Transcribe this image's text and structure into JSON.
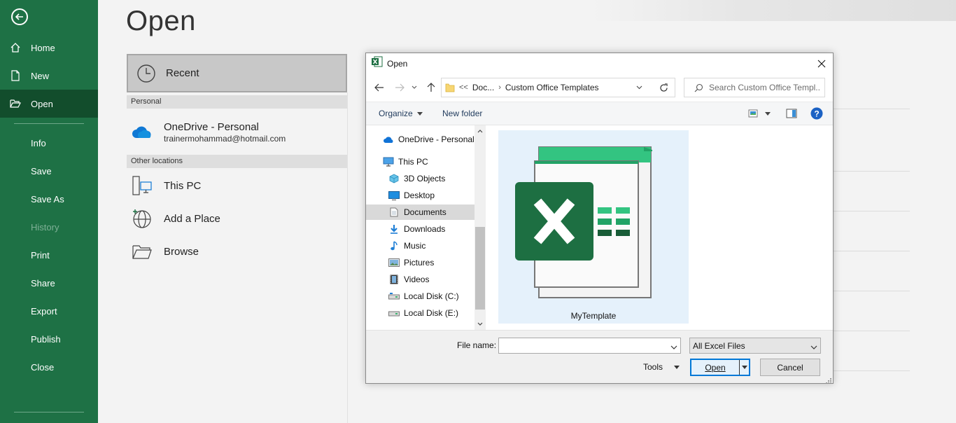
{
  "backstage": {
    "nav": {
      "home": "Home",
      "new": "New",
      "open": "Open",
      "info": "Info",
      "save": "Save",
      "save_as": "Save As",
      "history": "History",
      "print": "Print",
      "share": "Share",
      "export": "Export",
      "publish": "Publish",
      "close": "Close"
    },
    "title": "Open",
    "recent": "Recent",
    "personal_header": "Personal",
    "onedrive": {
      "label": "OneDrive - Personal",
      "email": "trainermohammad@hotmail.com"
    },
    "other_header": "Other locations",
    "this_pc": "This PC",
    "add_place": "Add a Place",
    "browse": "Browse"
  },
  "dialog": {
    "title": "Open",
    "address": {
      "prefix": "<<",
      "crumb1": "Doc...",
      "crumb2": "Custom Office Templates"
    },
    "search_placeholder": "Search Custom Office Templ...",
    "organize": "Organize",
    "new_folder": "New folder",
    "tree": [
      {
        "label": "OneDrive - Personal",
        "icon": "cloud-icon"
      },
      {
        "label": "This PC",
        "icon": "computer-icon"
      },
      {
        "label": "3D Objects",
        "icon": "cube-icon"
      },
      {
        "label": "Desktop",
        "icon": "desktop-icon"
      },
      {
        "label": "Documents",
        "icon": "document-icon"
      },
      {
        "label": "Downloads",
        "icon": "download-arrow-icon"
      },
      {
        "label": "Music",
        "icon": "music-note-icon"
      },
      {
        "label": "Pictures",
        "icon": "pictures-icon"
      },
      {
        "label": "Videos",
        "icon": "film-icon"
      },
      {
        "label": "Local Disk (C:)",
        "icon": "drive-icon"
      },
      {
        "label": "Local Disk (E:)",
        "icon": "drive-icon"
      }
    ],
    "selected_tree_item": "Documents",
    "file": {
      "name": "MyTemplate",
      "icon": "excel-template-icon"
    },
    "file_name_label": "File name:",
    "file_name_value": "",
    "file_type": "All Excel Files",
    "tools": "Tools",
    "open_button": "Open",
    "cancel_button": "Cancel"
  },
  "colors": {
    "nav_bg": "#1e7145",
    "nav_active": "#124d2c",
    "excel_green": "#1d6f42",
    "selection": "#e5f1fb",
    "accent": "#0078d7"
  }
}
